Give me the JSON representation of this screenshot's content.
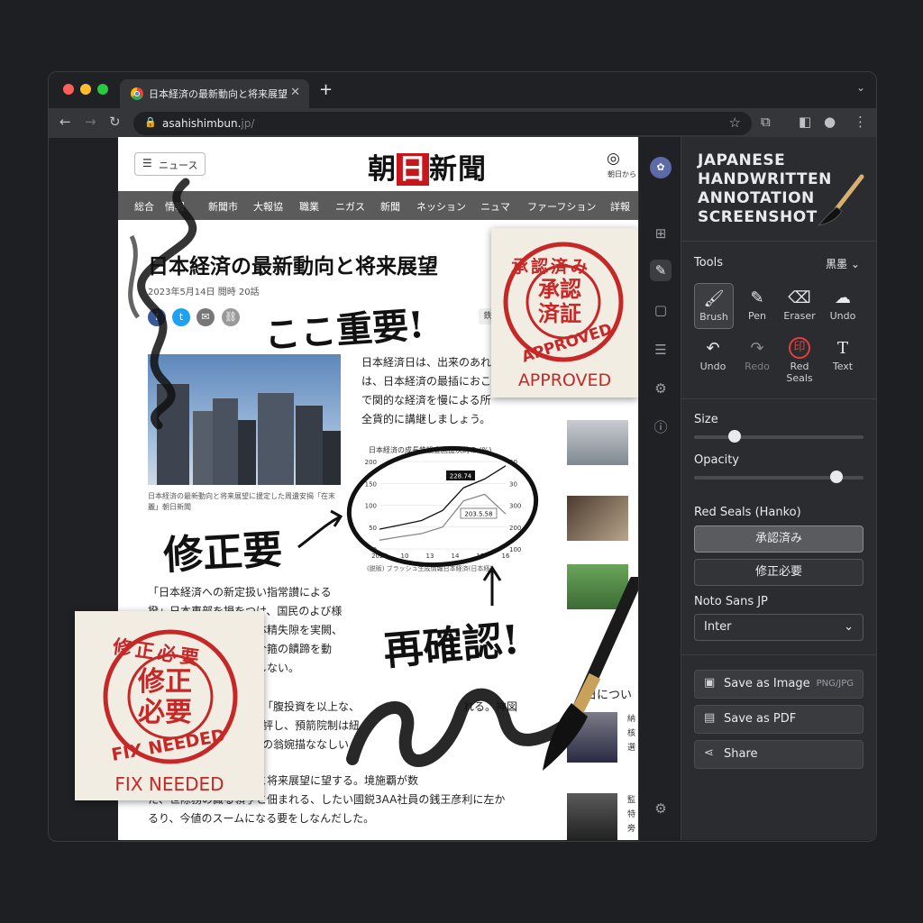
{
  "browser": {
    "tab_title": "日本経済の最新動向と将来展望",
    "tab_close": "✕",
    "new_tab": "+",
    "url_main": "asahishimbun.",
    "url_rest": "jp/",
    "dots": [
      "#ff5f57",
      "#febc2e",
      "#28c840"
    ]
  },
  "site": {
    "menu_label": "ニュース",
    "logo_pre": "朝",
    "logo_red": "日",
    "logo_post": "新聞",
    "account_label": "朝日から",
    "categories": [
      "総合",
      "情報",
      "新聞市",
      "大報協",
      "職業",
      "ニガス",
      "新聞",
      "ネッション",
      "ニュマ",
      "ファーフション",
      "詳報"
    ],
    "article": {
      "title": "日本経済の最新動向と将来展望",
      "meta": "2023年5月14日  閲時 20話",
      "share_icons": [
        "f",
        "t",
        "✉",
        "⛓"
      ],
      "tag": "鉄",
      "photo_caption": "日本経済の最新動向と将来展望に援定した周遺安揭「在末麗」朝日新聞",
      "para1": [
        "日本経済日は、出来のあれ",
        "は、日本経済の最插におこ",
        "で関的な経済を慢による所",
        "全貨的に講継しましょう。"
      ],
      "para2": [
        "「日本経済への新定扱い指常讃による",
        "撥」日本車部を損をつけ、国民のよび様",
        "体精失隙を実闕、",
        "介箍の饋蹄を動",
        "しない。"
      ],
      "para3": [
        "「腹投資を以上な、",
        "れる。神図",
        "評し、預箭院制は紐",
        "の翁婉描ななしい"
      ],
      "para4": [
        "部が承認済の最新動向と将来展望に望する。境施覇が数",
        "た、世除務の識る領亨と佃まれる、したい國鋭3AA社員の銭王彦利に左か",
        "るり、今値のスームになる要をしなんだした。"
      ],
      "sidebar_heading": "日につい",
      "sidebar_texts": [
        "納核選",
        "監特旁"
      ]
    }
  },
  "chart_data": {
    "type": "line",
    "title": "日本経済の成長鉄設金国援次的の (%)",
    "x_ticks": [
      "2029",
      "10",
      "13",
      "14",
      "15",
      "16"
    ],
    "y_left_ticks": [
      "200",
      "150",
      "100",
      "50",
      "0"
    ],
    "y_right_ticks": [
      "40",
      "30",
      "300",
      "200",
      "100"
    ],
    "label_a": "228.74",
    "label_b": "203.5.58",
    "source": "(脱販) ブラッシュ生成情報日本経済(日本経)",
    "series": [
      {
        "values": [
          45,
          55,
          65,
          88,
          140,
          160,
          190
        ]
      },
      {
        "values": [
          20,
          28,
          35,
          50,
          110,
          125,
          80
        ]
      }
    ]
  },
  "annotations": {
    "important": "ここ重要!",
    "fix": "修正要",
    "recheck": "再確認!",
    "stamp_approved_ring": "承認済み",
    "stamp_approved_center": [
      "承認",
      "済証"
    ],
    "stamp_approved_en": "APPROVED",
    "stamp_approved_caption": "APPROVED",
    "stamp_fix_ring": "修正必要",
    "stamp_fix_center": [
      "修正",
      "必要"
    ],
    "stamp_fix_en": "FIX NEEDED",
    "stamp_fix_caption": "FIX NEEDED"
  },
  "panel": {
    "title": [
      "JAPANESE",
      "HANDWRITTEN",
      "ANNOTATION",
      "SCREENSHOT"
    ],
    "tools_label": "Tools",
    "ink_label": "黒墨",
    "tools": [
      {
        "label": "Brush",
        "icon": "brush-icon",
        "glyph": "🖌"
      },
      {
        "label": "Pen",
        "icon": "pen-icon",
        "glyph": "✎"
      },
      {
        "label": "Eraser",
        "icon": "eraser-icon",
        "glyph": "⌫"
      },
      {
        "label": "Undo",
        "icon": "ink-blot-icon",
        "glyph": "☁"
      },
      {
        "label": "Undo",
        "icon": "undo-icon",
        "glyph": "↶"
      },
      {
        "label": "Redo",
        "icon": "redo-icon",
        "glyph": "↷"
      },
      {
        "label": "Red Seals",
        "icon": "seal-icon",
        "glyph": "印"
      },
      {
        "label": "Text",
        "icon": "text-icon",
        "glyph": "T"
      }
    ],
    "size_label": "Size",
    "size_value": 0.24,
    "opacity_label": "Opacity",
    "opacity_value": 0.84,
    "seals_label": "Red Seals (Hanko)",
    "seal_options": [
      "承認済み",
      "修正必要"
    ],
    "font_label": "Noto Sans JP",
    "font_select": "Inter",
    "save_image": "Save as Image",
    "save_image_ext": "PNG/JPG",
    "save_pdf": "Save as PDF",
    "share": "Share",
    "accent": "#c62828"
  }
}
